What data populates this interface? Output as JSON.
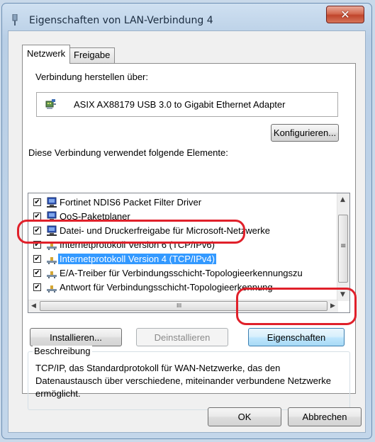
{
  "window": {
    "title": "Eigenschaften von LAN-Verbindung 4",
    "close_glyph": "✕"
  },
  "tabs": [
    {
      "label": "Netzwerk",
      "active": true
    },
    {
      "label": "Freigabe",
      "active": false
    }
  ],
  "connection": {
    "label": "Verbindung herstellen über:",
    "adapter_name": "ASIX AX88179 USB 3.0 to Gigabit Ethernet Adapter",
    "configure_button": "Konfigurieren..."
  },
  "components": {
    "label": "Diese Verbindung verwendet folgende Elemente:",
    "items": [
      {
        "label": "Fortinet NDIS6 Packet Filter Driver",
        "checked": true,
        "icon": "network-client-icon"
      },
      {
        "label": "QoS-Paketplaner",
        "checked": true,
        "icon": "network-service-icon"
      },
      {
        "label": "Datei- und Druckerfreigabe für Microsoft-Netzwerke",
        "checked": true,
        "icon": "network-service-icon"
      },
      {
        "label": "Internetprotokoll Version 6 (TCP/IPv6)",
        "checked": true,
        "icon": "protocol-icon"
      },
      {
        "label": "Internetprotokoll Version 4 (TCP/IPv4)",
        "checked": true,
        "icon": "protocol-icon",
        "selected": true
      },
      {
        "label": "E/A-Treiber für Verbindungsschicht-Topologieerkennungszu",
        "checked": true,
        "icon": "protocol-icon"
      },
      {
        "label": "Antwort für Verbindungsschicht-Topologieerkennung",
        "checked": true,
        "icon": "protocol-icon"
      }
    ],
    "check_glyph": "✔",
    "scroll_up": "▲",
    "scroll_down": "▼",
    "scroll_left": "◀",
    "scroll_right": "▶",
    "vthumb_grip": "≡",
    "hthumb_grip": "III"
  },
  "buttons": {
    "install": "Installieren...",
    "uninstall": "Deinstallieren",
    "properties": "Eigenschaften",
    "ok": "OK",
    "cancel": "Abbrechen"
  },
  "description": {
    "legend": "Beschreibung",
    "text": "TCP/IP, das Standardprotokoll für WAN-Netzwerke, das den Datenaustausch über verschiedene, miteinander verbundene Netzwerke ermöglicht."
  },
  "colors": {
    "selection": "#3399ff",
    "highlight_annotation": "#e0202a"
  }
}
